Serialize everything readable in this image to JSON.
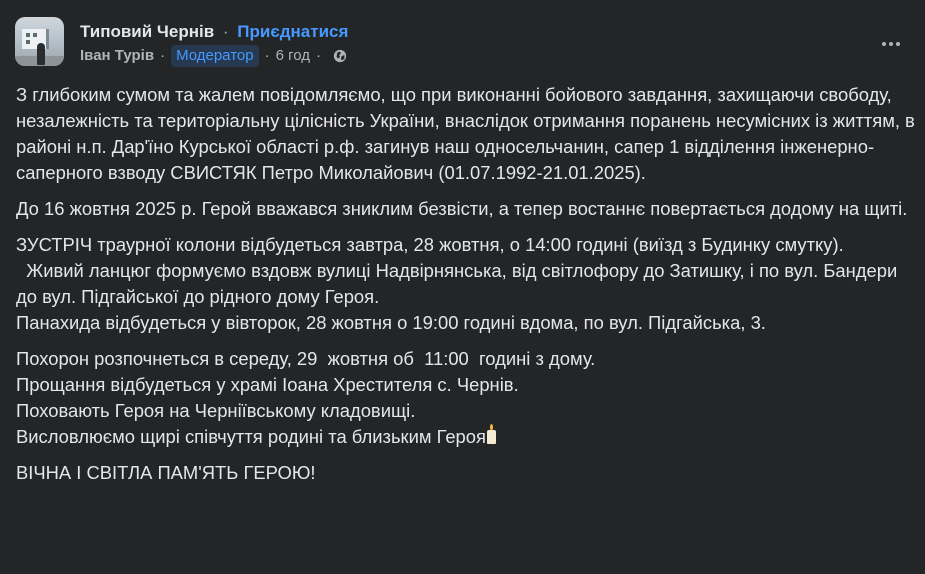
{
  "header": {
    "group_name": "Типовий Чернів",
    "dot": "·",
    "join_label": "Приєднатися",
    "author": "Іван Турів",
    "sep1": "·",
    "role_badge": "Модератор",
    "sep2": "·",
    "time": "6 год",
    "sep3": "·",
    "privacy_icon": "globe-icon",
    "more_icon": "more-options-icon"
  },
  "post": {
    "paragraphs": [
      "З глибоким сумом та жалем повідомляємо, що при виконанні бойового завдання, захищаючи свободу, незалежність та територіальну цілісність України, внаслідок отримання поранень несумісних із життям, в районі н.п. Дар'їно Курської області р.ф. загинув наш односельчанин, сапер 1 відділення інженерно-саперного взводу СВИСТЯК Петро Миколайович (01.07.1992-21.01.2025).",
      "До 16 жовтня 2025 р. Герой вважався зниклим безвісти, а тепер востаннє повертається додому на щиті.",
      "ЗУСТРІЧ траурної колони відбудеться завтра, 28 жовтня,  о 14:00 годині (виїзд з Будинку смутку).",
      "  Живий ланцюг формуємо вздовж вулиці Надвірнянська, від світлофору до Затишку, і по вул. Бандери до вул. Підгайської до рідного дому Героя.",
      "Панахида відбудеться у вівторок, 28 жовтня о 19:00 годині вдома, по вул. Підгайська, 3.",
      "Похорон розпочнеться в середу, 29  жовтня об  11:00  годині з дому.",
      "Прощання відбудеться у храмі Іоана Хрестителя с. Чернів.",
      "Поховають Героя на Черніївському кладовищі.",
      "Висловлюємо щирі співчуття родині та близьким Героя",
      "ВІЧНА І СВІТЛА ПАМ'ЯТЬ ГЕРОЮ!"
    ],
    "candle_icon": "candle-icon"
  }
}
